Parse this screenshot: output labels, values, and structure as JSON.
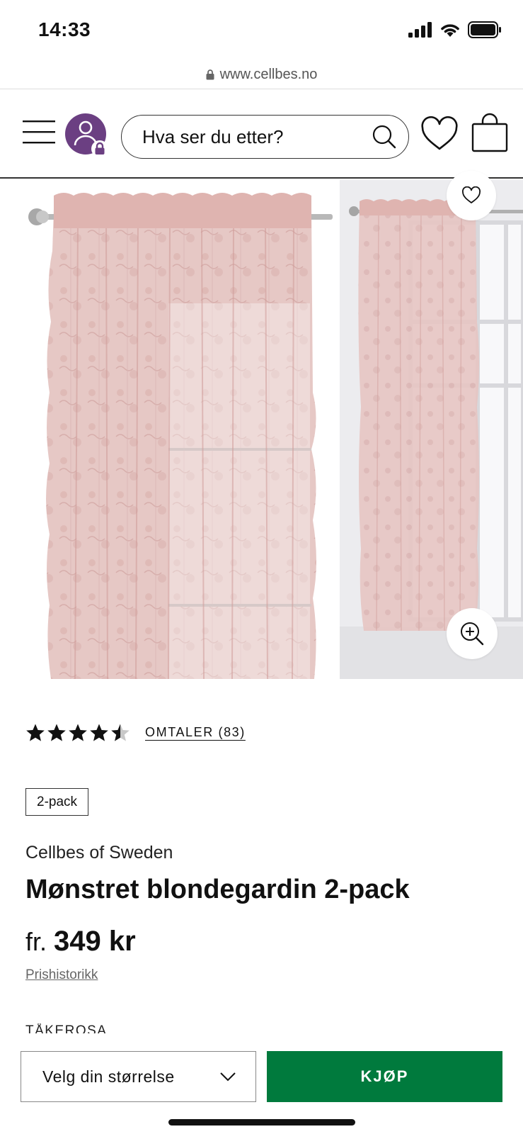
{
  "status_bar": {
    "time": "14:33"
  },
  "browser": {
    "url": "www.cellbes.no"
  },
  "header": {
    "search_placeholder": "Hva ser du etter?"
  },
  "product": {
    "rating": 4.5,
    "rating_max": 5,
    "reviews_label": "OMTALER (83)",
    "badge": "2-pack",
    "brand": "Cellbes of Sweden",
    "title": "Mønstret blondegardin 2-pack",
    "price_prefix": "fr.",
    "price": "349 kr",
    "price_history_link": "Prishistorikk",
    "color_label": "TÅKEROSA"
  },
  "bottom_bar": {
    "size_select_label": "Velg din størrelse",
    "buy_label": "KJØP"
  },
  "colors": {
    "buy_green": "#007a3d",
    "avatar_purple": "#6b3f82",
    "curtain_pink": "#e2bcb9"
  }
}
